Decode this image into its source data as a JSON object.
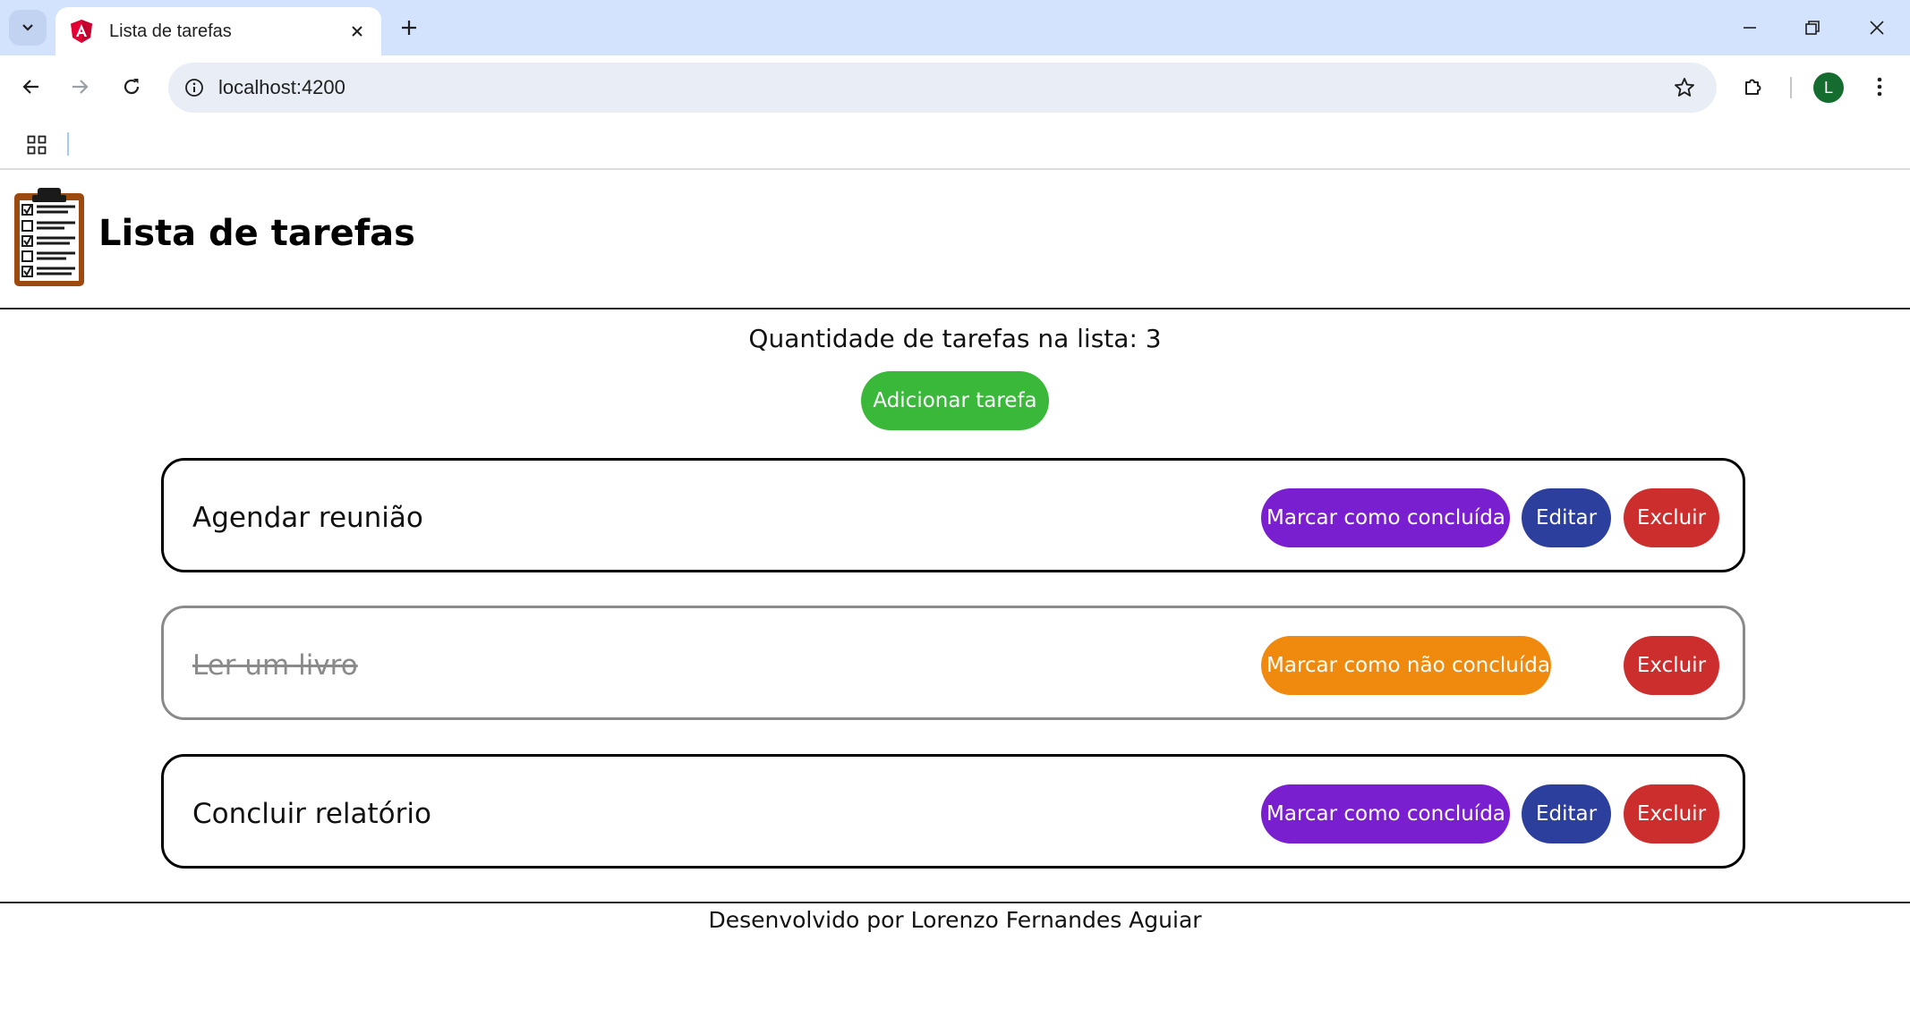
{
  "browser": {
    "tab_title": "Lista de tarefas",
    "url": "localhost:4200",
    "profile_initial": "L"
  },
  "app": {
    "title": "Lista de tarefas",
    "counter_text": "Quantidade de tarefas na lista: 3",
    "add_button": "Adicionar tarefa",
    "tasks": [
      {
        "name": "Agendar reunião",
        "done": false,
        "toggle_label": "Marcar como concluída",
        "edit_label": "Editar",
        "delete_label": "Excluir"
      },
      {
        "name": "Ler um livro",
        "done": true,
        "toggle_label": "Marcar como não concluída",
        "delete_label": "Excluir"
      },
      {
        "name": "Concluir relatório",
        "done": false,
        "toggle_label": "Marcar como concluída",
        "edit_label": "Editar",
        "delete_label": "Excluir"
      }
    ],
    "footer": "Desenvolvido por Lorenzo Fernandes Aguiar"
  },
  "colors": {
    "tabstrip": "#d3e3fd",
    "add_button": "#3ab83a",
    "mark_done": "#7a1fcf",
    "mark_undone": "#f08a0e",
    "edit": "#2d3f9c",
    "delete": "#cc2e2e"
  }
}
